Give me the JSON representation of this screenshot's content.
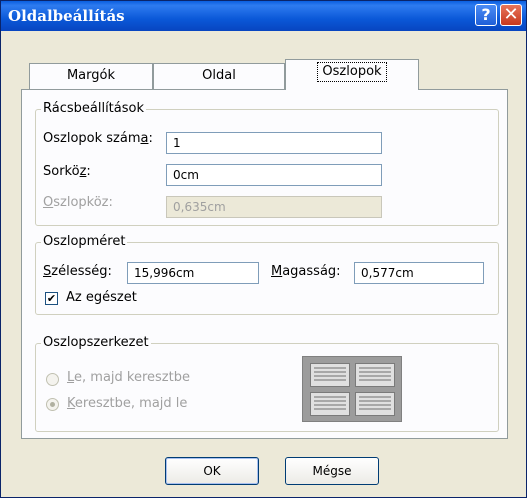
{
  "window": {
    "title": "Oldalbeállítás",
    "help_glyph": "?",
    "close_glyph": "✕"
  },
  "tabs": [
    {
      "label": "Margók",
      "active": false
    },
    {
      "label": "Oldal",
      "active": false
    },
    {
      "label": "Oszlopok",
      "active": true
    }
  ],
  "grid_settings": {
    "legend": "Rácsbeállítások",
    "columns_label_prefix": "Oszlopok szám",
    "columns_label_underlined": "a",
    "columns_label_suffix": ":",
    "columns_value": "1",
    "spacing_label_prefix": "Sorkö",
    "spacing_label_underlined": "z",
    "spacing_label_suffix": ":",
    "spacing_value": "0cm",
    "gutter_label_underlined": "O",
    "gutter_label_rest": "szlopköz:",
    "gutter_value": "0,635cm"
  },
  "column_size": {
    "legend": "Oszlopméret",
    "width_label_underlined": "S",
    "width_label_rest": "zélesség:",
    "width_value": "15,996cm",
    "height_label_underlined": "M",
    "height_label_rest": "agasság:",
    "height_value": "0,577cm",
    "whole_checkbox_label": "Az egészet",
    "whole_checked": true,
    "check_glyph": "✔"
  },
  "column_structure": {
    "legend": "Oszlopszerkezet",
    "option1_underlined": "L",
    "option1_rest": "e, majd keresztbe",
    "option2_underlined": "K",
    "option2_rest": "eresztbe, majd le",
    "selected": "option2"
  },
  "buttons": {
    "ok": "OK",
    "cancel": "Mégse"
  }
}
